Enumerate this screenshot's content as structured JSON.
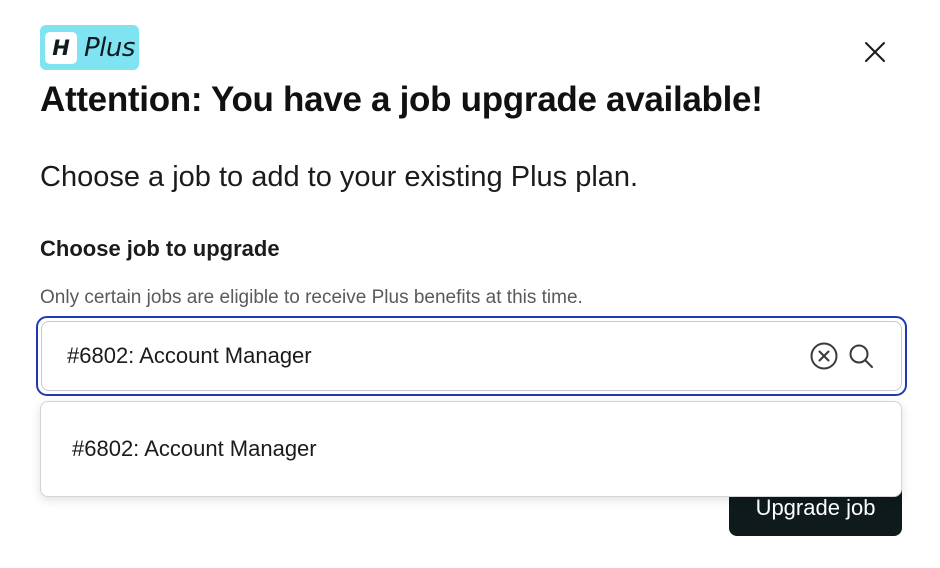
{
  "brand": {
    "mark": "H",
    "name": "Plus",
    "color": "#7fe3f2"
  },
  "dialog": {
    "title": "Attention: You have a job upgrade available!",
    "subtitle": "Choose a job to add to your existing Plus plan.",
    "field_label": "Choose job to upgrade",
    "field_help": "Only certain jobs are eligible to receive Plus benefits at this time."
  },
  "search": {
    "value": "#6802: Account Manager",
    "focus_color": "#1f3bb3"
  },
  "dropdown": {
    "options": [
      "#6802: Account Manager"
    ]
  },
  "actions": {
    "upgrade_label": "Upgrade job",
    "button_color": "#0e1a1c"
  },
  "icons": {
    "close": "close-icon",
    "clear": "clear-circle-icon",
    "search": "search-icon"
  }
}
